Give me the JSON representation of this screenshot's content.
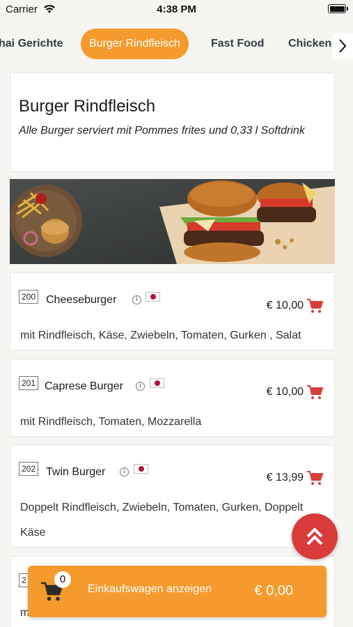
{
  "status_bar": {
    "carrier": "Carrier",
    "time": "4:38 PM"
  },
  "tabs": [
    {
      "label": "hai Gerichte",
      "active": false
    },
    {
      "label": "Burger Rindfleisch",
      "active": true
    },
    {
      "label": "Fast Food",
      "active": false
    },
    {
      "label": "Chicken",
      "active": false
    }
  ],
  "category": {
    "title": "Burger Rindfleisch",
    "subtitle": "Alle Burger serviert mit Pommes frites und 0,33 l Softdrink"
  },
  "items": [
    {
      "number": "200",
      "name": "Cheeseburger",
      "price": "€ 10,00",
      "description": "mit Rindfleisch, Käse, Zwiebeln, Tomaten, Gurken , Salat"
    },
    {
      "number": "201",
      "name": "Caprese Burger",
      "price": "€ 10,00",
      "description": "mit Rindfleisch, Tomaten, Mozzarella"
    },
    {
      "number": "202",
      "name": "Twin Burger",
      "price": "€ 13,99",
      "description": "Doppelt Rindfleisch, Zwiebeln, Tomaten, Gurken, Doppelt Käse"
    },
    {
      "number": "2",
      "description": "mit Rindfleisch, Schinken, Tomaten, Gurken, Ananas,"
    }
  ],
  "cart": {
    "count": "0",
    "label": "Einkaufswagen anzeigen",
    "total": "€ 0,00"
  },
  "colors": {
    "accent": "#f59a2d",
    "cart_icon": "#d93b3b",
    "scroll_button": "#d93b3b"
  }
}
